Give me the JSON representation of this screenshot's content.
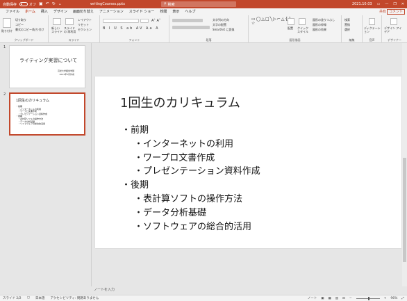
{
  "titlebar": {
    "autosave": "自動保存",
    "autosave_state": "オフ",
    "filename": "writingCourses.pptx",
    "search_placeholder": "検索",
    "user": "2021.10.03",
    "min": "—",
    "restore": "❐",
    "close": "✕"
  },
  "menu": {
    "tabs": [
      {
        "label": "ファイル"
      },
      {
        "label": "ホーム",
        "active": true
      },
      {
        "label": "挿入"
      },
      {
        "label": "デザイン"
      },
      {
        "label": "画面切り替え"
      },
      {
        "label": "アニメーション"
      },
      {
        "label": "スライド ショー"
      },
      {
        "label": "校閲"
      },
      {
        "label": "表示"
      },
      {
        "label": "ヘルプ"
      }
    ],
    "share": "共有",
    "comment": "コメント"
  },
  "ribbon": {
    "groups": {
      "clipboard": "クリップボード",
      "slides": "スライド",
      "font": "フォント",
      "paragraph": "段落",
      "drawing": "図形描画",
      "editing": "編集",
      "voice": "音声",
      "designer": "デザイナー"
    },
    "items": {
      "paste": "貼り付け",
      "cut": "切り取り",
      "copy": "コピー",
      "format_painter": "書式のコピー/貼り付け",
      "new_slide": "新しい スライド",
      "reuse_slide": "スライドの 再利用",
      "layout": "レイアウト",
      "reset": "リセット",
      "section": "セクション",
      "text_direction": "文字列の方向",
      "align_text": "文字の配置",
      "smartart": "SmartArt に変換",
      "arrange": "配置",
      "quick_styles": "クイック スタイル",
      "shape_fill": "図形の塗りつぶし",
      "shape_outline": "図形の枠線",
      "shape_effects": "図形の効果",
      "find": "検索",
      "replace": "置換",
      "select": "選択",
      "dictate": "ディクテーション",
      "design_ideas": "デザイン アイデア"
    }
  },
  "thumbnails": [
    {
      "num": "1",
      "title": "ライティング実習について",
      "sub1": "高松大学経営学部",
      "sub2": "2021年3月作成"
    },
    {
      "num": "2",
      "title": "1回生のカリキュラム",
      "lines": [
        "・前期",
        "　・インターネットの利用",
        "　・ワープロ文書作成",
        "　・プレゼンテーション資料作成",
        "・後期",
        "　・表計算ソフトの操作方法",
        "　・データ分析基礎",
        "　・ソフトウェアの総合的活用"
      ]
    }
  ],
  "slide": {
    "title": "1回生のカリキュラム",
    "lines": [
      {
        "text": "・前期",
        "level": 1
      },
      {
        "text": "・インターネットの利用",
        "level": 2
      },
      {
        "text": "・ワープロ文書作成",
        "level": 2
      },
      {
        "text": "・プレゼンテーション資料作成",
        "level": 2
      },
      {
        "text": "・後期",
        "level": 1
      },
      {
        "text": "・表計算ソフトの操作方法",
        "level": 2
      },
      {
        "text": "・データ分析基礎",
        "level": 2
      },
      {
        "text": "・ソフトウェアの総合的活用",
        "level": 2
      }
    ]
  },
  "notes_placeholder": "ノートを入力",
  "status": {
    "slide_info": "スライド 2/2",
    "language": "日本語",
    "accessibility": "アクセシビリティ: 問題ありません",
    "notes_btn": "ノート",
    "zoom": "96%"
  }
}
